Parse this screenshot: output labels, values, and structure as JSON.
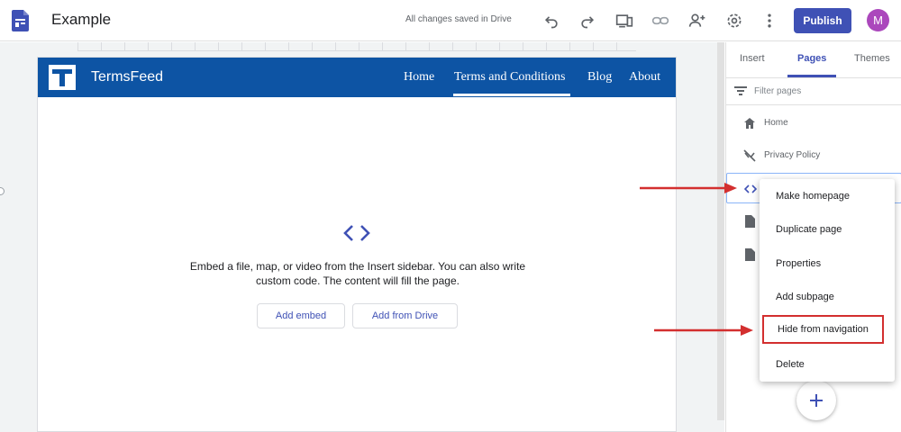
{
  "app": {
    "doc_title": "Example",
    "save_status": "All changes saved in Drive",
    "publish_label": "Publish",
    "avatar_initial": "M",
    "toolbar_icons": [
      "undo-icon",
      "redo-icon",
      "preview-icon",
      "link-icon",
      "share-icon",
      "settings-icon",
      "more-icon"
    ]
  },
  "site": {
    "name": "TermsFeed",
    "nav": [
      "Home",
      "Terms and Conditions",
      "Blog",
      "About"
    ],
    "active_nav": "Terms and Conditions"
  },
  "embed": {
    "message": "Embed a file, map, or video from the Insert sidebar. You can also write custom code. The content will fill the page.",
    "add_embed_label": "Add embed",
    "add_from_drive_label": "Add from Drive"
  },
  "sidebar": {
    "tabs": [
      "Insert",
      "Pages",
      "Themes"
    ],
    "active_tab": "Pages",
    "filter_placeholder": "Filter pages",
    "pages": [
      {
        "label": "Home",
        "icon": "home-icon"
      },
      {
        "label": "Privacy Policy",
        "icon": "hidden-page-icon"
      },
      {
        "label": "",
        "icon": "embed-page-icon"
      },
      {
        "label": "",
        "icon": "page-icon"
      },
      {
        "label": "",
        "icon": "page-icon"
      }
    ]
  },
  "context_menu": {
    "items": [
      "Make homepage",
      "Duplicate page",
      "Properties",
      "Add subpage",
      "Hide from navigation",
      "Delete"
    ],
    "highlighted": "Hide from navigation"
  },
  "colors": {
    "accent": "#3f51b5",
    "site_header": "#0d54a4",
    "annotation": "#d32f2f",
    "avatar": "#ab47bc"
  }
}
